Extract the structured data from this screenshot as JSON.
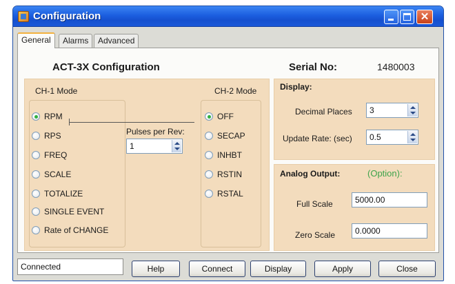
{
  "window": {
    "title": "Configuration"
  },
  "tabs": [
    {
      "label": "General"
    },
    {
      "label": "Alarms"
    },
    {
      "label": "Advanced"
    }
  ],
  "header": {
    "config_title": "ACT-3X Configuration",
    "serial_label": "Serial No:",
    "serial_value": "1480003"
  },
  "ch1": {
    "label": "CH-1 Mode",
    "selected": "RPM",
    "options": [
      "RPM",
      "RPS",
      "FREQ",
      "SCALE",
      "TOTALIZE",
      "SINGLE EVENT",
      "Rate of CHANGE"
    ],
    "pulses_label": "Pulses per Rev:",
    "pulses_value": "1"
  },
  "ch2": {
    "label": "CH-2 Mode",
    "selected": "OFF",
    "options": [
      "OFF",
      "SECAP",
      "INHBT",
      "RSTIN",
      "RSTAL"
    ]
  },
  "display": {
    "heading": "Display:",
    "decimal_label": "Decimal Places",
    "decimal_value": "3",
    "update_label": "Update Rate: (sec)",
    "update_value": "0.5"
  },
  "analog": {
    "heading": "Analog Output:",
    "option_note": "(Option):",
    "full_label": "Full Scale",
    "full_value": "5000.00",
    "zero_label": "Zero Scale",
    "zero_value": "0.0000"
  },
  "status": {
    "text": "Connected"
  },
  "buttons": {
    "help": "Help",
    "connect": "Connect",
    "display": "Display",
    "apply": "Apply",
    "close": "Close"
  },
  "colors": {
    "titlebar": "#1c5fe0",
    "group_bg": "#f3dcbd",
    "radio_selected": "#2fb13f",
    "option_note": "#3da34a"
  },
  "icons": {
    "app": "app-icon",
    "minimize": "minimize-icon",
    "maximize": "maximize-icon",
    "close": "close-icon"
  }
}
